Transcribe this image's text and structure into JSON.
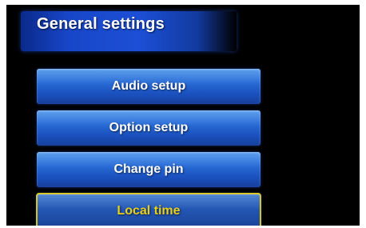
{
  "header": {
    "title": "General settings"
  },
  "menu": {
    "items": [
      {
        "label": "Audio setup",
        "selected": false
      },
      {
        "label": "Option setup",
        "selected": false
      },
      {
        "label": "Change pin",
        "selected": false
      },
      {
        "label": "Local time",
        "selected": true
      }
    ]
  },
  "colors": {
    "background": "#000000",
    "button_blue": "#2a6ed8",
    "selection_outline": "#d4c41a",
    "selected_text": "#e8cf1a"
  }
}
